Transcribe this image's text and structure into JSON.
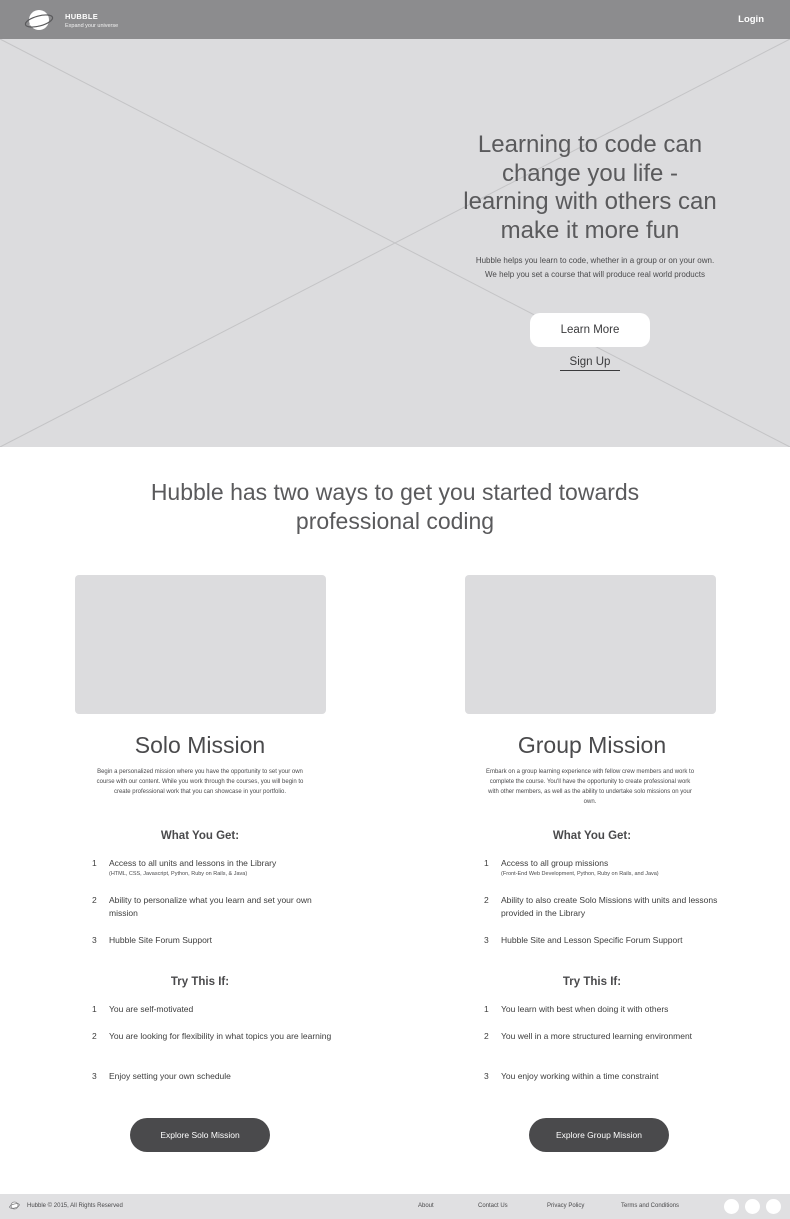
{
  "header": {
    "brand_name": "HUBBLE",
    "brand_tagline": "Expand your universe",
    "login_label": "Login",
    "logo_icon": "planet-logo-icon"
  },
  "hero": {
    "title": "Learning to code can change you life - learning with others can make it more fun",
    "body": "Hubble helps you learn to code, whether in a group or on your own. We help you set a course that will produce real world products",
    "learn_more_label": "Learn More",
    "sign_up_label": "Sign Up",
    "image_placeholder": "image-placeholder-icon"
  },
  "section": {
    "heading": "Hubble has two ways to get you started towards professional coding"
  },
  "solo": {
    "title": "Solo Mission",
    "description": "Begin a personalized mission where you have the opportunity to set your own course with our content. While you work through the courses, you will begin to create professional work that you can showcase in your portfolio.",
    "what_heading": "What You Get:",
    "what_items": [
      {
        "num": "1",
        "text": "Access to all units and lessons in the Library",
        "note": "(HTML, CSS, Javascript, Python, Ruby on Rails, & Java)"
      },
      {
        "num": "2",
        "text": "Ability to personalize what you learn and set your own mission",
        "note": ""
      },
      {
        "num": "3",
        "text": "Hubble Site Forum Support",
        "note": ""
      }
    ],
    "try_heading": "Try This If:",
    "try_items": [
      {
        "num": "1",
        "text": "You are self-motivated"
      },
      {
        "num": "2",
        "text": "You are looking for flexibility in what topics you are learning"
      },
      {
        "num": "3",
        "text": "Enjoy setting your own schedule"
      }
    ],
    "cta_label": "Explore Solo Mission"
  },
  "group": {
    "title": "Group Mission",
    "description": "Embark on a group learning experience with fellow crew members and work to complete the course. You'll have the opportunity to create professional work with other members, as well as the ability to undertake solo missions on your own.",
    "what_heading": "What You Get:",
    "what_items": [
      {
        "num": "1",
        "text": "Access to all group missions",
        "note": "(Front-End Web Development, Python, Ruby on Rails, and Java)"
      },
      {
        "num": "2",
        "text": "Ability to also create Solo Missions with units and lessons provided in the Library",
        "note": ""
      },
      {
        "num": "3",
        "text": "Hubble Site and Lesson Specific Forum Support",
        "note": ""
      }
    ],
    "try_heading": "Try This If:",
    "try_items": [
      {
        "num": "1",
        "text": "You learn with best when doing it with others"
      },
      {
        "num": "2",
        "text": "You well in a more structured learning environment"
      },
      {
        "num": "3",
        "text": "You enjoy working within a time constraint"
      }
    ],
    "cta_label": "Explore Group Mission"
  },
  "footer": {
    "copyright": "Hubble © 2015, All Rights Reserved",
    "links": [
      "About",
      "Contact Us",
      "Privacy Policy",
      "Terms and Conditions"
    ],
    "social_icons": [
      "social-icon-1",
      "social-icon-2",
      "social-icon-3"
    ]
  },
  "colors": {
    "header_bg": "#8c8c8e",
    "placeholder_bg": "#dcdcde",
    "button_dark": "#4a4a4c",
    "footer_bg": "#e0e0e2"
  }
}
